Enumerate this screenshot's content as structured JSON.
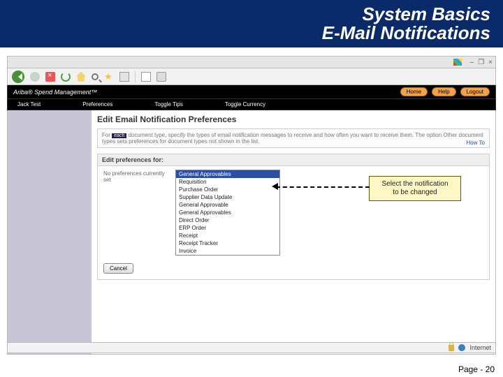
{
  "slide": {
    "title_line1": "System Basics",
    "title_line2": "E-Mail Notifications",
    "page_label": "Page - 20"
  },
  "window_controls": {
    "min": "–",
    "max": "❐",
    "close": "×"
  },
  "ariba": {
    "brand": "Ariba® Spend Management™",
    "home": "Home",
    "help": "Help",
    "logout": "Logout"
  },
  "menubar": {
    "user": "Jack Test",
    "preferences": "Preferences",
    "toggle_tips": "Toggle Tips",
    "toggle_currency": "Toggle Currency"
  },
  "page": {
    "heading": "Edit Email Notification Preferences",
    "instr_prefix": "For",
    "instr_badge": "each",
    "instr_rest": "document type, specify the types of email notification messages to receive and how often you want to receive them. The option Other document types sets preferences for document types not shown in the list.",
    "how_to": "How To",
    "pref_head": "Edit preferences for:",
    "no_pref": "No preferences currently set",
    "cancel": "Cancel",
    "dropdown": {
      "selected": "General Approvables",
      "options": [
        "Requisition",
        "Purchase Order",
        "Supplier Data Update",
        "General Approvable",
        "General Approvables",
        "Direct Order",
        "ERP Order",
        "Receipt",
        "Receipt Tracker",
        "Invoice"
      ]
    }
  },
  "callout": {
    "line1": "Select the notification",
    "line2": "to be changed"
  },
  "status": {
    "internet": "Internet"
  }
}
